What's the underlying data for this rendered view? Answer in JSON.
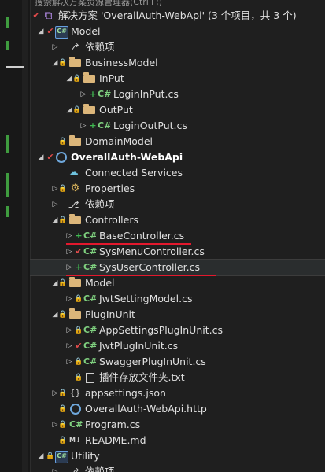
{
  "header_text": "搜索解决方案资源管理器(Ctrl+;)",
  "solution": {
    "label": "解决方案 'OverallAuth-WebApi' (3 个项目，共 3 个)"
  },
  "tree": [
    {
      "label": "Model",
      "icon": "csharp-project-icon"
    },
    {
      "label": "依赖项",
      "icon": "dependencies-icon"
    },
    {
      "label": "BusinessModel",
      "icon": "folder-icon"
    },
    {
      "label": "InPut",
      "icon": "folder-icon"
    },
    {
      "label": "LoginInPut.cs",
      "icon": "csharp-file-icon"
    },
    {
      "label": "OutPut",
      "icon": "folder-icon"
    },
    {
      "label": "LoginOutPut.cs",
      "icon": "csharp-file-icon"
    },
    {
      "label": "DomainModel",
      "icon": "folder-icon"
    },
    {
      "label": "OverallAuth-WebApi",
      "icon": "web-project-icon"
    },
    {
      "label": "Connected Services",
      "icon": "connected-services-icon"
    },
    {
      "label": "Properties",
      "icon": "properties-icon"
    },
    {
      "label": "依赖项",
      "icon": "dependencies-icon"
    },
    {
      "label": "Controllers",
      "icon": "folder-icon"
    },
    {
      "label": "BaseController.cs",
      "icon": "csharp-file-icon"
    },
    {
      "label": "SysMenuController.cs",
      "icon": "csharp-file-icon"
    },
    {
      "label": "SysUserController.cs",
      "icon": "csharp-file-icon"
    },
    {
      "label": "Model",
      "icon": "folder-icon"
    },
    {
      "label": "JwtSettingModel.cs",
      "icon": "csharp-file-icon"
    },
    {
      "label": "PlugInUnit",
      "icon": "folder-icon"
    },
    {
      "label": "AppSettingsPlugInUnit.cs",
      "icon": "csharp-file-icon"
    },
    {
      "label": "JwtPlugInUnit.cs",
      "icon": "csharp-file-icon"
    },
    {
      "label": "SwaggerPlugInUnit.cs",
      "icon": "csharp-file-icon"
    },
    {
      "label": "插件存放文件夹.txt",
      "icon": "text-file-icon"
    },
    {
      "label": "appsettings.json",
      "icon": "json-file-icon"
    },
    {
      "label": "OverallAuth-WebApi.http",
      "icon": "http-file-icon"
    },
    {
      "label": "Program.cs",
      "icon": "csharp-file-icon"
    },
    {
      "label": "README.md",
      "icon": "markdown-file-icon"
    },
    {
      "label": "Utility",
      "icon": "csharp-project-icon"
    },
    {
      "label": "依赖项",
      "icon": "dependencies-icon"
    }
  ],
  "colors": {
    "background": "#1f1f1f",
    "selected_row": "#2a2d2e",
    "underline": "#e3182d",
    "added_status": "#3fb950",
    "modified_status": "#e14b4b",
    "folder": "#dcb67a"
  }
}
